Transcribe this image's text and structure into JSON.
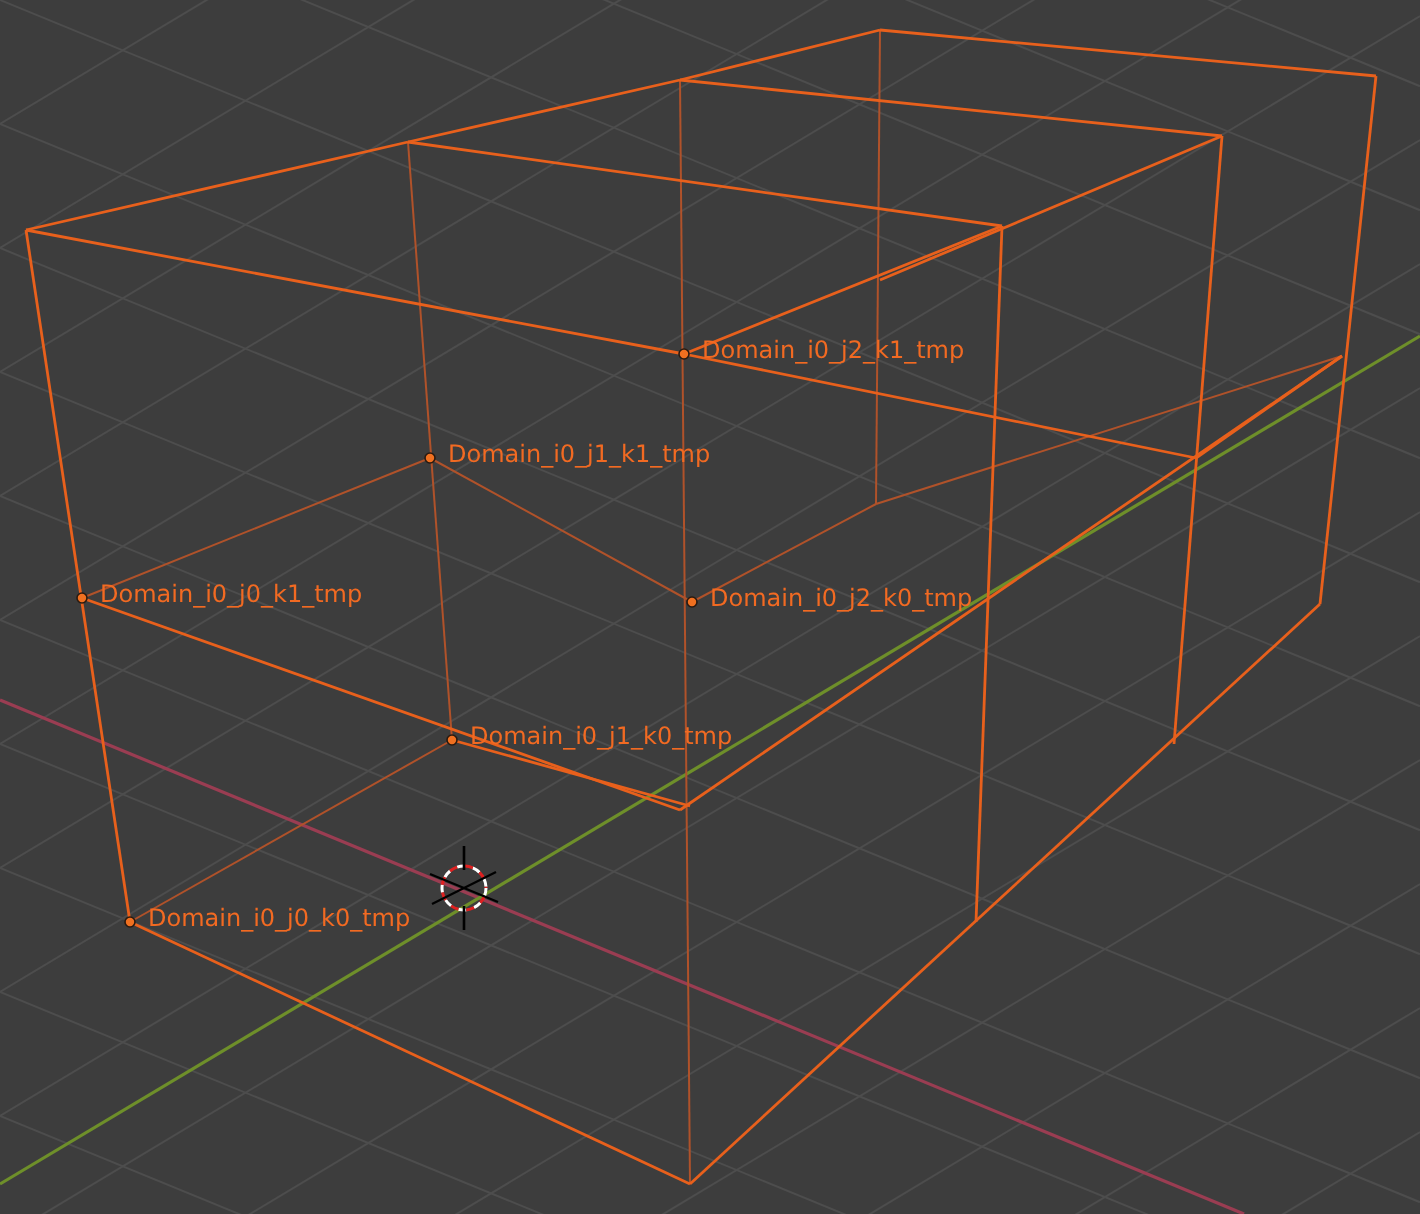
{
  "viewport": {
    "objects": [
      {
        "label": "Domain_i0_j2_k1_tmp"
      },
      {
        "label": "Domain_i0_j1_k1_tmp"
      },
      {
        "label": "Domain_i0_j0_k1_tmp"
      },
      {
        "label": "Domain_i0_j2_k0_tmp"
      },
      {
        "label": "Domain_i0_j1_k0_tmp"
      },
      {
        "label": "Domain_i0_j0_k0_tmp"
      }
    ]
  }
}
